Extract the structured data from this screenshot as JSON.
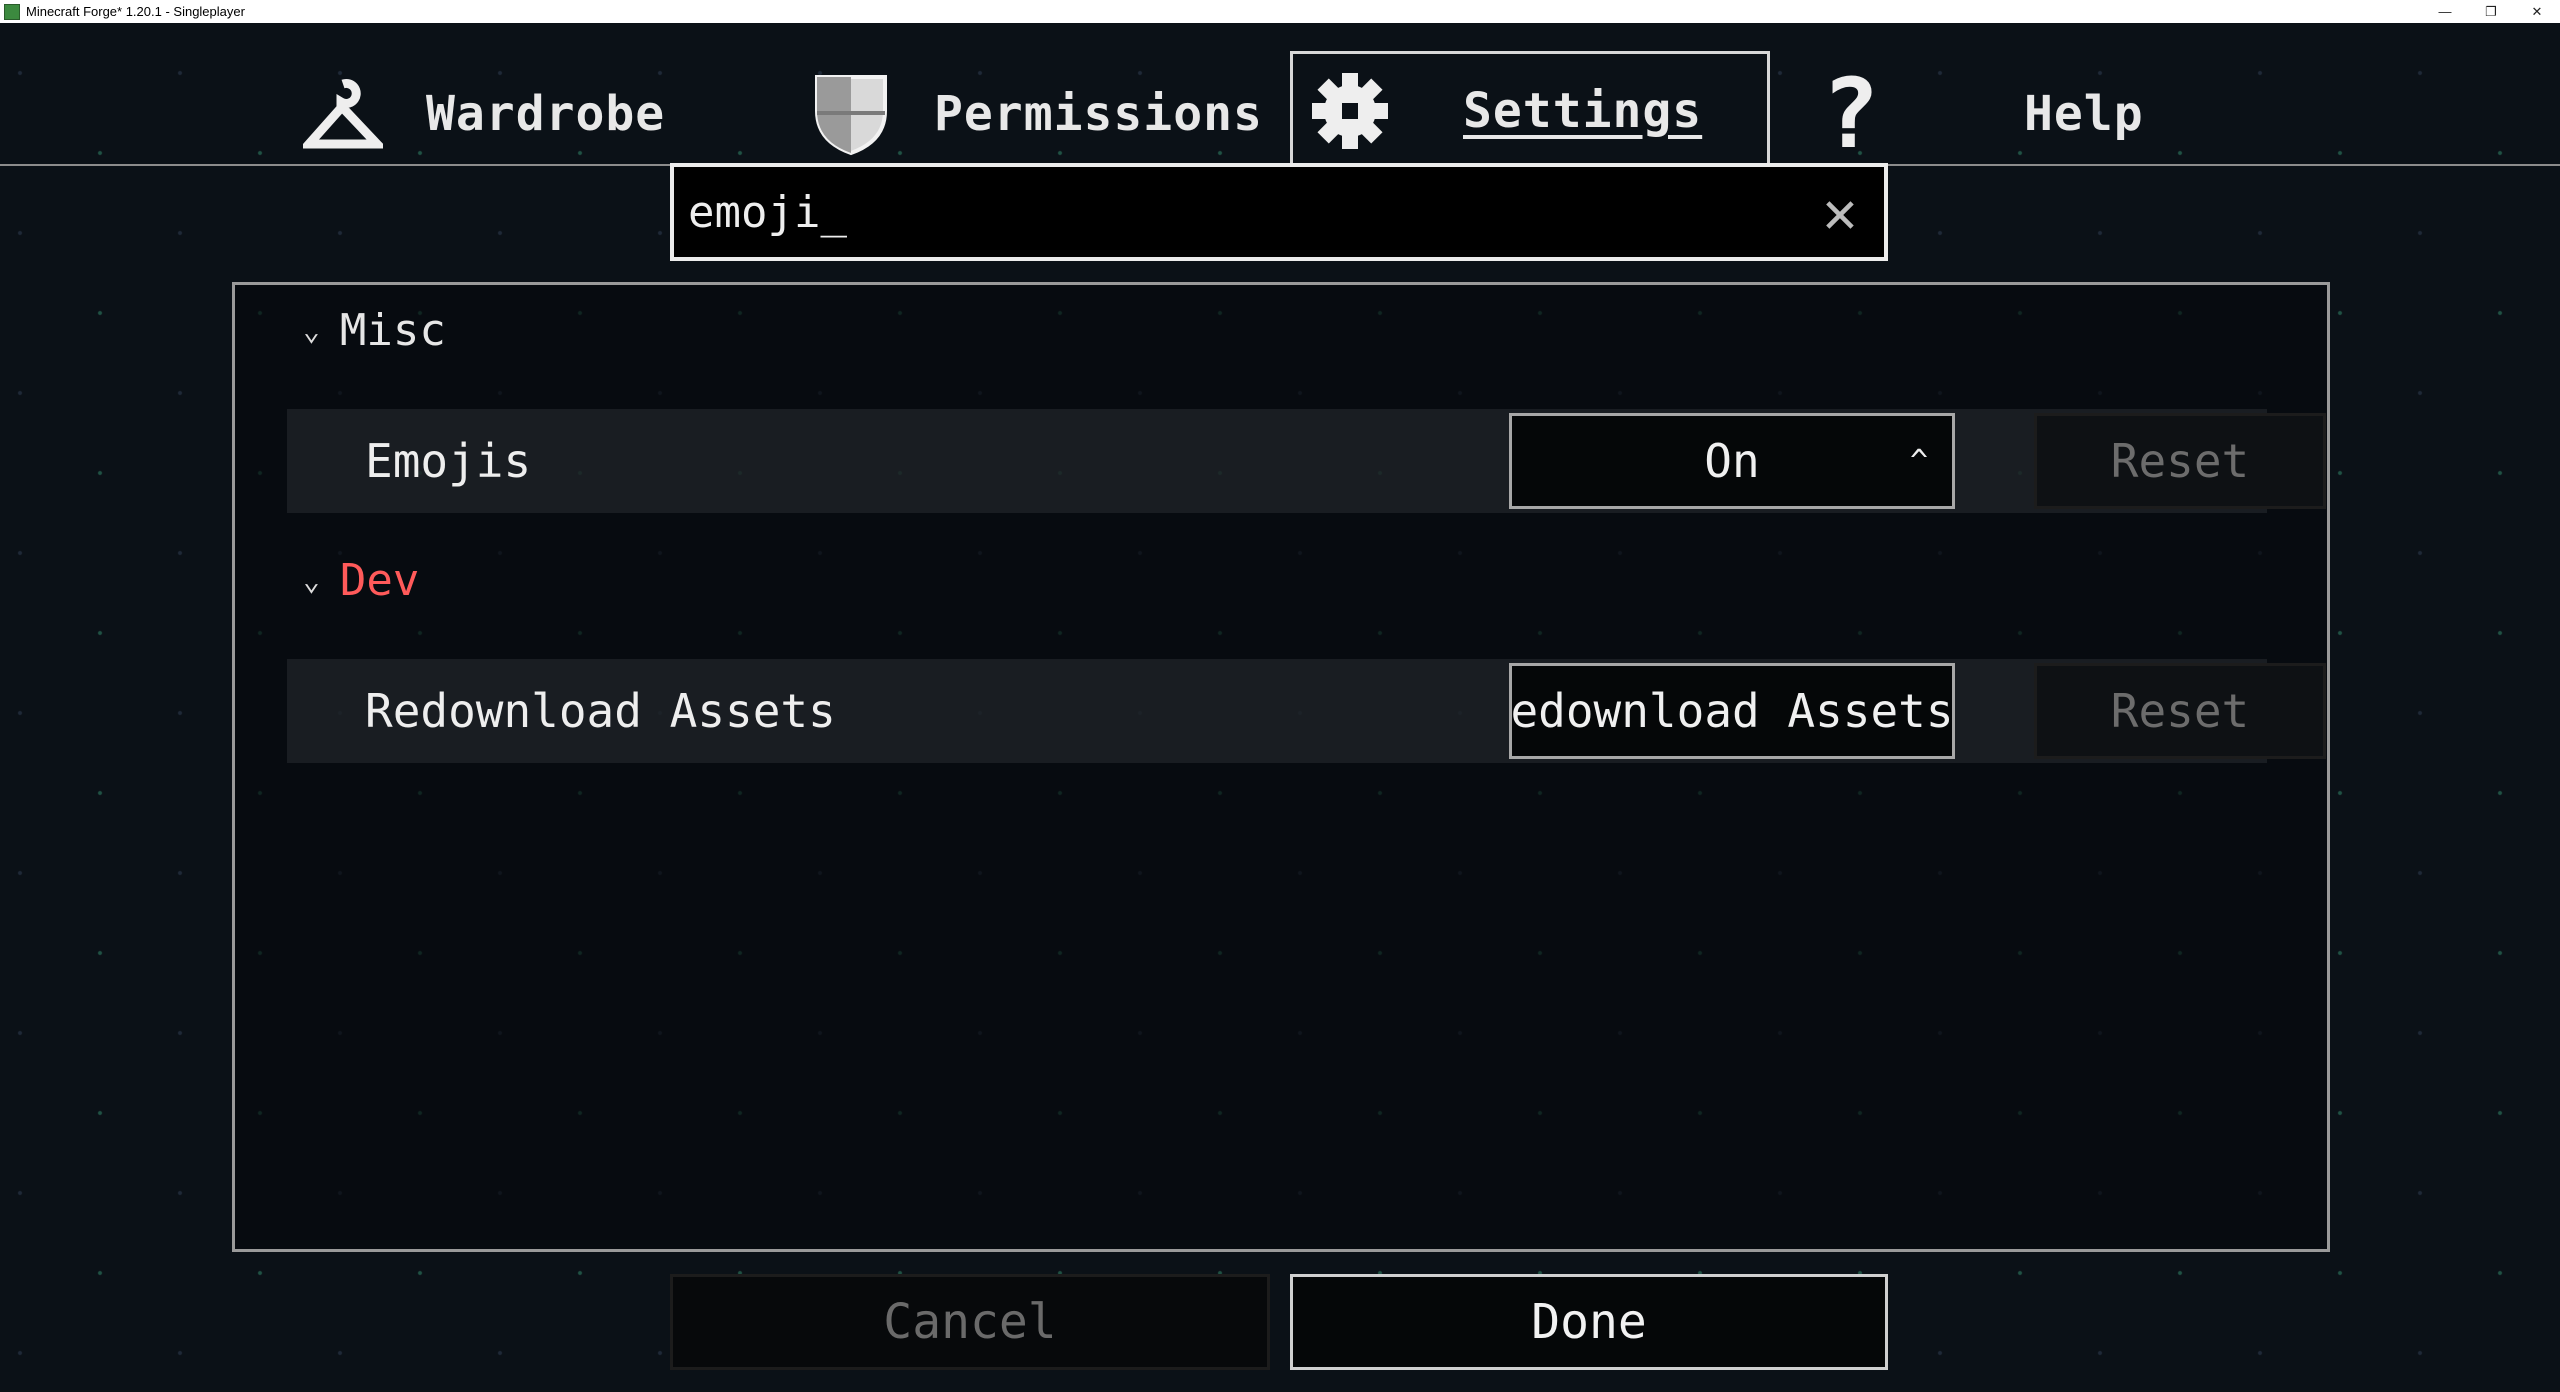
{
  "window": {
    "title": "Minecraft Forge* 1.20.1 - Singleplayer"
  },
  "tabs": [
    {
      "label": "Wardrobe",
      "icon": "hanger-icon"
    },
    {
      "label": "Permissions",
      "icon": "shield-icon"
    },
    {
      "label": "Settings",
      "icon": "gear-icon",
      "active": true
    },
    {
      "label": "Help",
      "icon": "question-icon"
    }
  ],
  "search": {
    "value": "emoji_"
  },
  "categories": {
    "misc": {
      "label": "Misc"
    },
    "dev": {
      "label": "Dev",
      "color": "#ff5a5a"
    }
  },
  "settings": {
    "emojis": {
      "label": "Emojis",
      "value": "On",
      "reset_label": "Reset"
    },
    "redownload": {
      "label": "Redownload Assets",
      "button_label": "edownload Assets",
      "reset_label": "Reset"
    }
  },
  "footer": {
    "cancel_label": "Cancel",
    "done_label": "Done"
  }
}
